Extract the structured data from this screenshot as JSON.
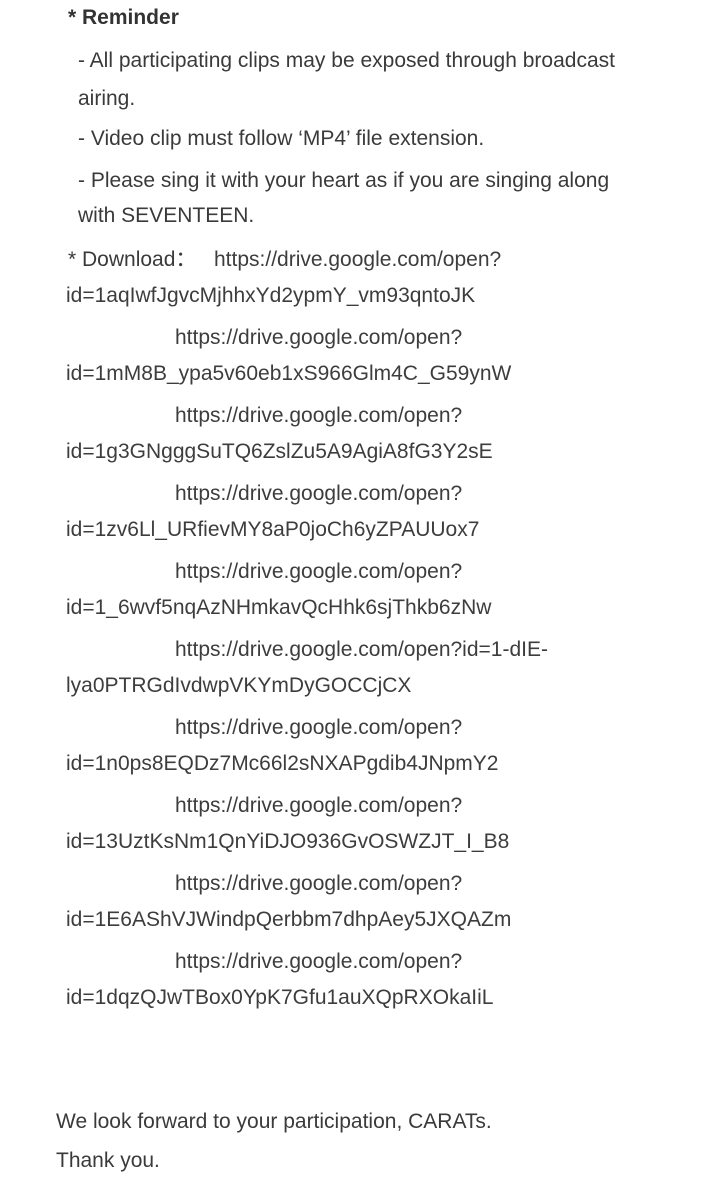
{
  "reminder": {
    "heading": "* Reminder",
    "items": [
      {
        "line1": "- All participating clips may be exposed through broadcast",
        "line2": "airing."
      },
      {
        "line1": "- Video clip must follow ‘MP4’ file extension.",
        "line2": ""
      },
      {
        "line1": "- Please sing it with your heart as if you are singing along",
        "line2": "with SEVENTEEN."
      }
    ]
  },
  "download": {
    "label": "* Download：",
    "links": [
      {
        "part1": "https://drive.google.com/open?",
        "part2": "id=1aqIwfJgvcMjhhxYd2ypmY_vm93qntoJK"
      },
      {
        "part1": "https://drive.google.com/open?",
        "part2": "id=1mM8B_ypa5v60eb1xS966Glm4C_G59ynW"
      },
      {
        "part1": "https://drive.google.com/open?",
        "part2": "id=1g3GNgggSuTQ6ZslZu5A9AgiA8fG3Y2sE"
      },
      {
        "part1": "https://drive.google.com/open?",
        "part2": "id=1zv6Ll_URfievMY8aP0joCh6yZPAUUox7"
      },
      {
        "part1": "https://drive.google.com/open?",
        "part2": "id=1_6wvf5nqAzNHmkavQcHhk6sjThkb6zNw"
      },
      {
        "part1": "https://drive.google.com/open?id=1-dIE-",
        "part2": "lya0PTRGdIvdwpVKYmDyGOCCjCX"
      },
      {
        "part1": "https://drive.google.com/open?",
        "part2": "id=1n0ps8EQDz7Mc66l2sNXAPgdib4JNpmY2"
      },
      {
        "part1": "https://drive.google.com/open?",
        "part2": "id=13UztKsNm1QnYiDJO936GvOSWZJT_I_B8"
      },
      {
        "part1": "https://drive.google.com/open?",
        "part2": "id=1E6AShVJWindpQerbbm7dhpAey5JXQAZm"
      },
      {
        "part1": "https://drive.google.com/open?",
        "part2": "id=1dqzQJwTBox0YpK7Gfu1auXQpRXOkaIiL"
      }
    ]
  },
  "closing": {
    "line1": "We look forward to your participation, CARATs.",
    "line2": "Thank you."
  }
}
